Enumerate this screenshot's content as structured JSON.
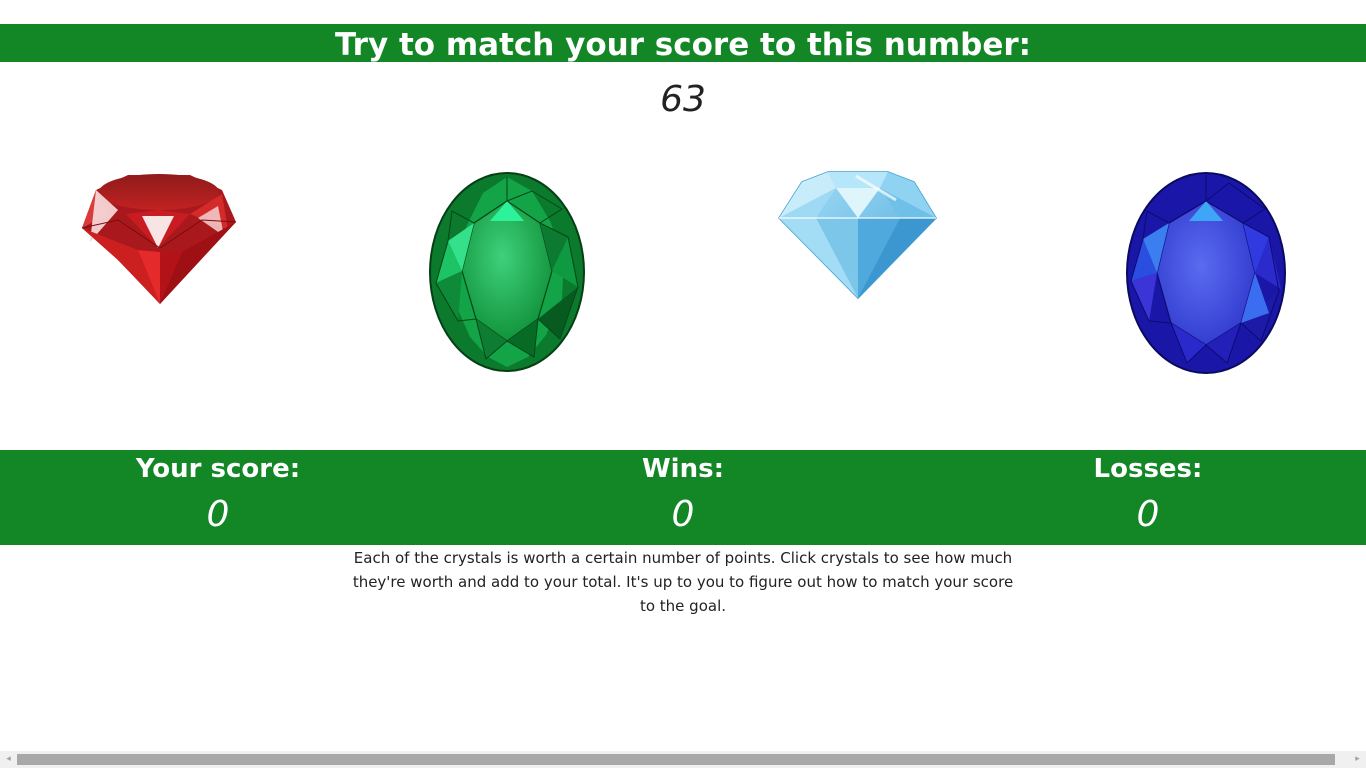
{
  "header": {
    "title": "Try to match your score to this number:",
    "target_number": "63"
  },
  "crystals": [
    {
      "name": "ruby",
      "color": "#c0171c"
    },
    {
      "name": "emerald",
      "color": "#0f9a3a"
    },
    {
      "name": "diamond",
      "color": "#79c9ee"
    },
    {
      "name": "sapphire",
      "color": "#2a2ad0"
    }
  ],
  "stats": {
    "score_label": "Your score:",
    "score_value": "0",
    "wins_label": "Wins:",
    "wins_value": "0",
    "losses_label": "Losses:",
    "losses_value": "0"
  },
  "instructions": "Each of the crystals is worth a certain number of points. Click crystals to see how much they're worth and add to your total. It's up to you to figure out how to match your score to the goal.",
  "colors": {
    "banner": "#138626",
    "banner_text": "#ffffff",
    "page_bg": "#ffffff"
  },
  "scrollbar": {
    "left_arrow_icon": "◂",
    "right_arrow_icon": "▸"
  }
}
